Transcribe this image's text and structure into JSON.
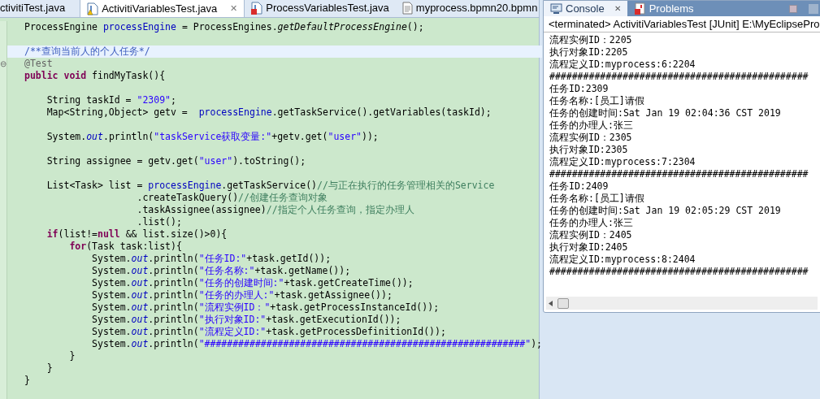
{
  "editor": {
    "tabs": [
      {
        "label": "ctivitiTest.java",
        "selected": false
      },
      {
        "label": "ActivitiVariablesTest.java",
        "kind": "java-warning",
        "selected": true,
        "close": "✕"
      },
      {
        "label": "ProcessVariablesTest.java",
        "kind": "java-error",
        "selected": false
      },
      {
        "label": "myprocess.bpmn20.bpmn",
        "kind": "file",
        "selected": false
      }
    ],
    "lines": [
      {
        "kind": "code",
        "highlighted": false,
        "tokens": [
          {
            "kind": "plain",
            "text": "ProcessEngine "
          },
          {
            "kind": "field",
            "text": "processEngine"
          },
          {
            "kind": "plain",
            "text": " = ProcessEngines."
          },
          {
            "kind": "static",
            "text": "getDefaultProcessEngine"
          },
          {
            "kind": "plain",
            "text": "();"
          }
        ]
      },
      {
        "kind": "blank",
        "highlighted": false
      },
      {
        "kind": "code",
        "highlighted": true,
        "tokens": [
          {
            "kind": "javadoc",
            "text": "/**查询当前人的个人任务*/"
          }
        ]
      },
      {
        "kind": "code",
        "highlighted": false,
        "fold": "⊖",
        "tokens": [
          {
            "kind": "annotation",
            "text": "@Test"
          }
        ]
      },
      {
        "kind": "code",
        "highlighted": false,
        "tokens": [
          {
            "kind": "keyword",
            "text": "public void"
          },
          {
            "kind": "plain",
            "text": " findMyTask(){"
          }
        ]
      },
      {
        "kind": "blank",
        "highlighted": false
      },
      {
        "kind": "code",
        "highlighted": false,
        "tokens": [
          {
            "kind": "plain",
            "text": "    String taskId = "
          },
          {
            "kind": "string",
            "text": "\"2309\""
          },
          {
            "kind": "plain",
            "text": ";"
          }
        ]
      },
      {
        "kind": "code",
        "highlighted": false,
        "tokens": [
          {
            "kind": "plain",
            "text": "    Map<String,Object> getv =  "
          },
          {
            "kind": "field",
            "text": "processEngine"
          },
          {
            "kind": "plain",
            "text": ".getTaskService().getVariables(taskId);"
          }
        ]
      },
      {
        "kind": "blank",
        "highlighted": false
      },
      {
        "kind": "code",
        "highlighted": false,
        "tokens": [
          {
            "kind": "plain",
            "text": "    System."
          },
          {
            "kind": "static-field",
            "text": "out"
          },
          {
            "kind": "plain",
            "text": ".println("
          },
          {
            "kind": "string",
            "text": "\"taskService获取变量:\""
          },
          {
            "kind": "plain",
            "text": "+getv.get("
          },
          {
            "kind": "string",
            "text": "\"user\""
          },
          {
            "kind": "plain",
            "text": "));"
          }
        ]
      },
      {
        "kind": "blank",
        "highlighted": false
      },
      {
        "kind": "code",
        "highlighted": false,
        "tokens": [
          {
            "kind": "plain",
            "text": "    String assignee = getv.get("
          },
          {
            "kind": "string",
            "text": "\"user\""
          },
          {
            "kind": "plain",
            "text": ").toString();"
          }
        ]
      },
      {
        "kind": "blank",
        "highlighted": false
      },
      {
        "kind": "code",
        "highlighted": false,
        "tokens": [
          {
            "kind": "plain",
            "text": "    List<Task> list = "
          },
          {
            "kind": "field",
            "text": "processEngine"
          },
          {
            "kind": "plain",
            "text": ".getTaskService()"
          },
          {
            "kind": "comment",
            "text": "//与正在执行的任务管理相关的Service"
          }
        ]
      },
      {
        "kind": "code",
        "highlighted": false,
        "tokens": [
          {
            "kind": "plain",
            "text": "                    .createTaskQuery()"
          },
          {
            "kind": "comment",
            "text": "//创建任务查询对象"
          }
        ]
      },
      {
        "kind": "code",
        "highlighted": false,
        "tokens": [
          {
            "kind": "plain",
            "text": "                    .taskAssignee(assignee)"
          },
          {
            "kind": "comment",
            "text": "//指定个人任务查询，指定办理人"
          }
        ]
      },
      {
        "kind": "code",
        "highlighted": false,
        "tokens": [
          {
            "kind": "plain",
            "text": "                    .list();"
          }
        ]
      },
      {
        "kind": "code",
        "highlighted": false,
        "tokens": [
          {
            "kind": "keyword",
            "text": "    if"
          },
          {
            "kind": "plain",
            "text": "(list!="
          },
          {
            "kind": "keyword",
            "text": "null"
          },
          {
            "kind": "plain",
            "text": " && list.size()>0){"
          }
        ]
      },
      {
        "kind": "code",
        "highlighted": false,
        "tokens": [
          {
            "kind": "keyword",
            "text": "        for"
          },
          {
            "kind": "plain",
            "text": "(Task task:list){"
          }
        ]
      },
      {
        "kind": "code",
        "highlighted": false,
        "tokens": [
          {
            "kind": "plain",
            "text": "            System."
          },
          {
            "kind": "static-field",
            "text": "out"
          },
          {
            "kind": "plain",
            "text": ".println("
          },
          {
            "kind": "string",
            "text": "\"任务ID:\""
          },
          {
            "kind": "plain",
            "text": "+task.getId());"
          }
        ]
      },
      {
        "kind": "code",
        "highlighted": false,
        "tokens": [
          {
            "kind": "plain",
            "text": "            System."
          },
          {
            "kind": "static-field",
            "text": "out"
          },
          {
            "kind": "plain",
            "text": ".println("
          },
          {
            "kind": "string",
            "text": "\"任务名称:\""
          },
          {
            "kind": "plain",
            "text": "+task.getName());"
          }
        ]
      },
      {
        "kind": "code",
        "highlighted": false,
        "tokens": [
          {
            "kind": "plain",
            "text": "            System."
          },
          {
            "kind": "static-field",
            "text": "out"
          },
          {
            "kind": "plain",
            "text": ".println("
          },
          {
            "kind": "string",
            "text": "\"任务的创建时间:\""
          },
          {
            "kind": "plain",
            "text": "+task.getCreateTime());"
          }
        ]
      },
      {
        "kind": "code",
        "highlighted": false,
        "tokens": [
          {
            "kind": "plain",
            "text": "            System."
          },
          {
            "kind": "static-field",
            "text": "out"
          },
          {
            "kind": "plain",
            "text": ".println("
          },
          {
            "kind": "string",
            "text": "\"任务的办理人:\""
          },
          {
            "kind": "plain",
            "text": "+task.getAssignee());"
          }
        ]
      },
      {
        "kind": "code",
        "highlighted": false,
        "tokens": [
          {
            "kind": "plain",
            "text": "            System."
          },
          {
            "kind": "static-field",
            "text": "out"
          },
          {
            "kind": "plain",
            "text": ".println("
          },
          {
            "kind": "string",
            "text": "\"流程实例ID：\""
          },
          {
            "kind": "plain",
            "text": "+task.getProcessInstanceId());"
          }
        ]
      },
      {
        "kind": "code",
        "highlighted": false,
        "tokens": [
          {
            "kind": "plain",
            "text": "            System."
          },
          {
            "kind": "static-field",
            "text": "out"
          },
          {
            "kind": "plain",
            "text": ".println("
          },
          {
            "kind": "string",
            "text": "\"执行对象ID:\""
          },
          {
            "kind": "plain",
            "text": "+task.getExecutionId());"
          }
        ]
      },
      {
        "kind": "code",
        "highlighted": false,
        "tokens": [
          {
            "kind": "plain",
            "text": "            System."
          },
          {
            "kind": "static-field",
            "text": "out"
          },
          {
            "kind": "plain",
            "text": ".println("
          },
          {
            "kind": "string",
            "text": "\"流程定义ID:\""
          },
          {
            "kind": "plain",
            "text": "+task.getProcessDefinitionId());"
          }
        ]
      },
      {
        "kind": "code",
        "highlighted": false,
        "tokens": [
          {
            "kind": "plain",
            "text": "            System."
          },
          {
            "kind": "static-field",
            "text": "out"
          },
          {
            "kind": "plain",
            "text": ".println("
          },
          {
            "kind": "string",
            "text": "\"#########################################################\""
          },
          {
            "kind": "plain",
            "text": ");"
          }
        ]
      },
      {
        "kind": "code",
        "highlighted": false,
        "tokens": [
          {
            "kind": "plain",
            "text": "        }"
          }
        ]
      },
      {
        "kind": "code",
        "highlighted": false,
        "tokens": [
          {
            "kind": "plain",
            "text": "    }"
          }
        ]
      },
      {
        "kind": "code",
        "highlighted": false,
        "tokens": [
          {
            "kind": "plain",
            "text": "}"
          }
        ]
      }
    ]
  },
  "console": {
    "tabs": [
      {
        "label": "Console",
        "kind": "console",
        "selected": true,
        "close": "✕"
      },
      {
        "label": "Problems",
        "kind": "problems",
        "selected": false
      }
    ],
    "status": "<terminated> ActivitiVariablesTest [JUnit] E:\\MyEclipsePro",
    "lines": [
      "流程实例ID：2205",
      "执行对象ID:2205",
      "流程定义ID:myprocess:6:2204",
      "##############################################",
      "任务ID:2309",
      "任务名称:[员工]请假",
      "任务的创建时间:Sat Jan 19 02:04:36 CST 2019",
      "任务的办理人:张三",
      "流程实例ID：2305",
      "执行对象ID:2305",
      "流程定义ID:myprocess:7:2304",
      "##############################################",
      "任务ID:2409",
      "任务名称:[员工]请假",
      "任务的创建时间:Sat Jan 19 02:05:29 CST 2019",
      "任务的办理人:张三",
      "流程实例ID：2405",
      "执行对象ID:2405",
      "流程定义ID:myprocess:8:2404",
      "##############################################"
    ]
  }
}
